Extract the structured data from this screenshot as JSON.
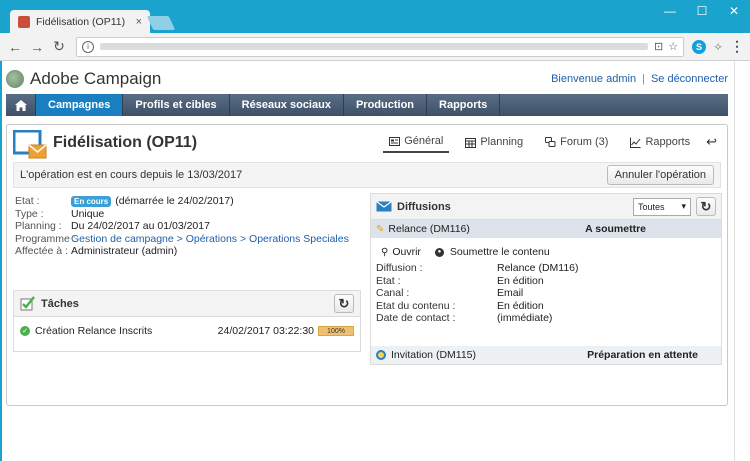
{
  "browser": {
    "tab_title": "Fidélisation (OP11)",
    "tab_close": "×",
    "window_controls": [
      "—",
      "☐",
      "✕"
    ]
  },
  "app": {
    "logo_text": "Adobe Campaign",
    "welcome": "Bienvenue admin",
    "logout": "Se déconnecter"
  },
  "nav": {
    "items": [
      {
        "label": "Campagnes",
        "active": true
      },
      {
        "label": "Profils et cibles",
        "active": false
      },
      {
        "label": "Réseaux sociaux",
        "active": false
      },
      {
        "label": "Production",
        "active": false
      },
      {
        "label": "Rapports",
        "active": false
      }
    ]
  },
  "operation": {
    "title": "Fidélisation (OP11)",
    "tabs": [
      {
        "label": "Général",
        "icon": "general-icon",
        "active": true
      },
      {
        "label": "Planning",
        "icon": "calendar-icon"
      },
      {
        "label": "Forum (3)",
        "icon": "forum-icon"
      },
      {
        "label": "Rapports",
        "icon": "chart-icon"
      }
    ],
    "status_text": "L'opération est en cours depuis le 13/03/2017",
    "cancel_button": "Annuler l'opération"
  },
  "properties": {
    "state_label": "Etat :",
    "state_badge": "En cours",
    "state_value": "(démarrée le 24/02/2017)",
    "type_label": "Type :",
    "type_value": "Unique",
    "planning_label": "Planning :",
    "planning_value": "Du 24/02/2017 au 01/03/2017",
    "program_label": "Programme :",
    "program_value": "Gestion de campagne > Opérations > Operations Speciales",
    "assigned_label": "Affectée à :",
    "assigned_value": "Administrateur (admin)"
  },
  "tasks": {
    "title": "Tâches",
    "items": [
      {
        "name": "Création Relance Inscrits",
        "date": "24/02/2017 03:22:30",
        "progress": "100%"
      }
    ]
  },
  "deliveries": {
    "title": "Diffusions",
    "filter": "Toutes",
    "items": [
      {
        "name": "Relance (DM116)",
        "state": "A soumettre",
        "actions": [
          "Ouvrir",
          "Soumettre le contenu"
        ],
        "details": [
          {
            "label": "Diffusion :",
            "value": "Relance (DM116)"
          },
          {
            "label": "Etat :",
            "value": "En édition"
          },
          {
            "label": "Canal :",
            "value": "Email"
          },
          {
            "label": "Etat du contenu :",
            "value": "En édition"
          },
          {
            "label": "Date de contact :",
            "value": "(immédiate)"
          }
        ]
      },
      {
        "name": "Invitation (DM115)",
        "state": "Préparation en attente"
      }
    ]
  }
}
